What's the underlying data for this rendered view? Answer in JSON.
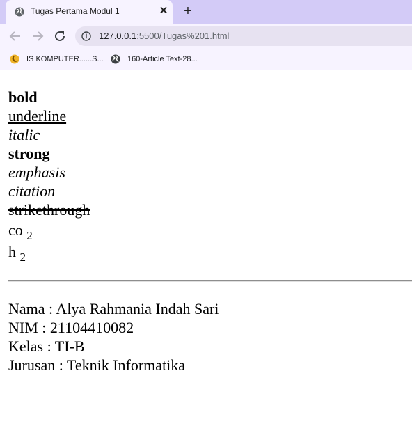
{
  "browser": {
    "tab_title": "Tugas Pertama Modul 1",
    "tab_close": "✕",
    "new_tab": "+",
    "url_host": "127.0.0.1",
    "url_path": ":5500/Tugas%201.html",
    "bookmarks": [
      {
        "label": "IS KOMPUTER......S...",
        "icon": "moon-star-icon"
      },
      {
        "label": "160-Article Text-28...",
        "icon": "globe-icon"
      }
    ]
  },
  "content": {
    "bold": "bold",
    "underline": "underline",
    "italic": "italic",
    "strong": "strong",
    "emphasis": "emphasis",
    "citation": "citation",
    "strikethrough": "strikethrough",
    "co_base": "co",
    "co_sub": "2",
    "h_base": "h",
    "h_sub": "2"
  },
  "info": {
    "nama": "Nama : Alya Rahmania Indah Sari",
    "nim": "NIM : 21104410082",
    "kelas": "Kelas : TI-B",
    "jurusan": "Jurusan : Teknik Informatika"
  }
}
